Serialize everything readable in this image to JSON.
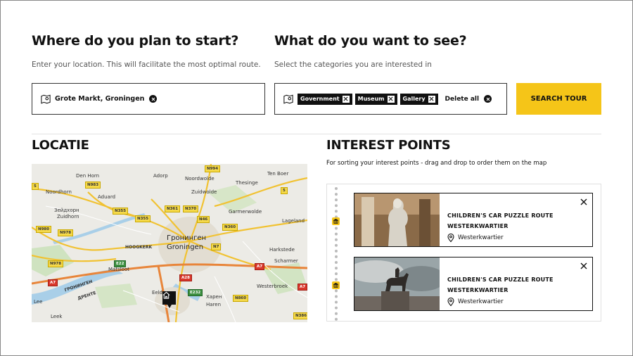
{
  "start": {
    "heading": "Where do you plan to start?",
    "subtitle": "Enter your location. This will facilitate the most optimal route.",
    "location_value": "Grote Markt, Groningen"
  },
  "categories": {
    "heading": "What do you want to see?",
    "subtitle": "Select the categories you are interested in",
    "tags": [
      "Government",
      "Museum",
      "Gallery"
    ],
    "delete_all": "Delete all"
  },
  "search_button": "SEARCH TOUR",
  "locatie": {
    "heading": "LOCATIE",
    "map_places": {
      "den_horn": "Den Horn",
      "adorp": "Adorp",
      "ten_boer": "Ten Boer",
      "noordhorn": "Noordhorn",
      "noordwolde": "Noordwolde",
      "zuidwolde": "Zuidwolde",
      "thesinge": "Thesinge",
      "aduard": "Aduard",
      "zeidhorn_cyr": "Зейдхорн",
      "zuidhorn": "Zuidhorn",
      "garmerwolde": "Garmerwolde",
      "lageland": "Lageland",
      "groningen_cyr": "Гронинген",
      "groningen": "Groningen",
      "hoogkerk": "HOOGKERK",
      "harkstede": "Harkstede",
      "matsloot": "Matsloot",
      "scharmer": "Scharmer",
      "groningen_cyr2": "ГРОНИНГЕН",
      "drente": "ДРЕНТЕ",
      "eelde": "Eelde",
      "westerbroek": "Westerbroek",
      "lee": "Lee",
      "leek": "Leek",
      "haren_cyr": "Харен",
      "haren": "Haren"
    },
    "road_labels": {
      "n994": "N994",
      "n983": "N983",
      "n355a": "N355",
      "n361": "N361",
      "n370": "N370",
      "n355b": "N355",
      "n46": "N46",
      "n360": "N360",
      "n980": "N980",
      "n978a": "N978",
      "n7": "N7",
      "e22": "E22",
      "n978b": "N978",
      "a7a": "A7",
      "a28": "A28",
      "a7b": "A7",
      "a7c": "A7",
      "e232": "E232",
      "n860": "N860",
      "n386": "N386",
      "n5": "5"
    }
  },
  "interest_points": {
    "heading": "INTEREST POINTS",
    "subtitle": "For sorting your interest points - drag and drop to order them on the map",
    "items": [
      {
        "title": "CHILDREN'S CAR PUZZLE ROUTE WESTERKWARTIER",
        "location": "Westerkwartier"
      },
      {
        "title": "CHILDREN'S CAR PUZZLE ROUTE WESTERKWARTIER",
        "location": "Westerkwartier"
      }
    ]
  }
}
